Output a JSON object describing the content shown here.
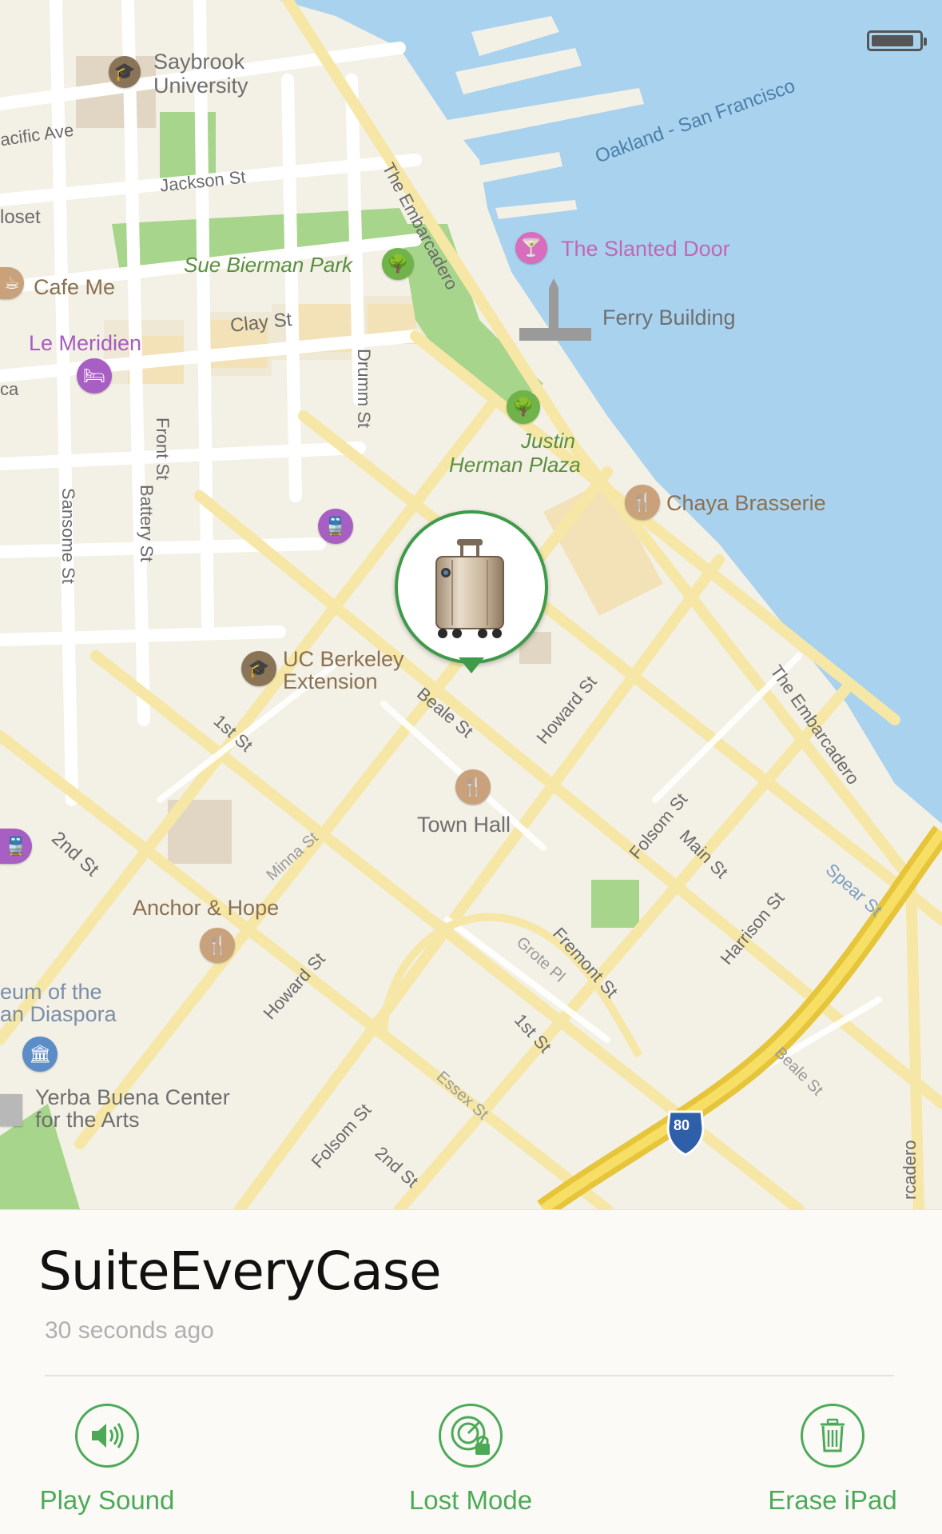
{
  "map": {
    "labels": {
      "saybrook": "Saybrook University",
      "saybrook_line1": "Saybrook",
      "saybrook_line2": "University",
      "pacific_ave": "acific Ave",
      "jackson_st": "Jackson St",
      "closet": "loset",
      "sue_bierman": "Sue Bierman Park",
      "cafe_me": "Cafe Me",
      "clay_st": "Clay St",
      "le_meridien": "Le Meridien",
      "ca": "ca",
      "front_st": "Front St",
      "drumm_st": "Drumm St",
      "embarcadero_top": "The Embarcadero",
      "oakland_sf": "Oakland - San Francisco",
      "slanted_door": "The Slanted Door",
      "ferry_building": "Ferry Building",
      "justin_herman_1": "Justin",
      "justin_herman_2": "Herman Plaza",
      "chaya": "Chaya Brasserie",
      "sansome_st": "Sansome St",
      "battery_st": "Battery St",
      "uc_berkeley_1": "UC Berkeley",
      "uc_berkeley_2": "Extension",
      "beale_st": "Beale St",
      "howard_st": "Howard St",
      "embarcadero_right": "The Embarcadero",
      "first_st": "1st St",
      "town_hall": "Town Hall",
      "folsom_st": "Folsom St",
      "main_st": "Main St",
      "minna_st": "Minna St",
      "second_st": "2nd St",
      "anchor_hope": "Anchor & Hope",
      "harrison_st": "Harrison St",
      "spear_st": "Spear St",
      "grote_pl": "Grote Pl",
      "fremont_st": "Fremont St",
      "howard_st_2": "Howard St",
      "museum_1": "eum of the",
      "museum_2": "an Diaspora",
      "first_st_2": "1st St",
      "essex_st": "Essex St",
      "beale_st_2": "Beale St",
      "yerba_1": "Yerba Buena Center",
      "yerba_2": "for the Arts",
      "folsom_st_2": "Folsom St",
      "second_st_2": "2nd St",
      "interstate": "80",
      "embarcadero_bottom": "rcadero"
    }
  },
  "device": {
    "name": "SuiteEveryCase",
    "last_seen": "30 seconds ago"
  },
  "actions": {
    "play_sound": "Play Sound",
    "lost_mode": "Lost Mode",
    "erase": "Erase iPad"
  },
  "colors": {
    "accent": "#4caa57",
    "pin_ring": "#3f9b4a",
    "water": "#a9d2ef",
    "park": "#a6d58b",
    "road_major": "#f4e19a",
    "highway": "#e6c53a"
  }
}
